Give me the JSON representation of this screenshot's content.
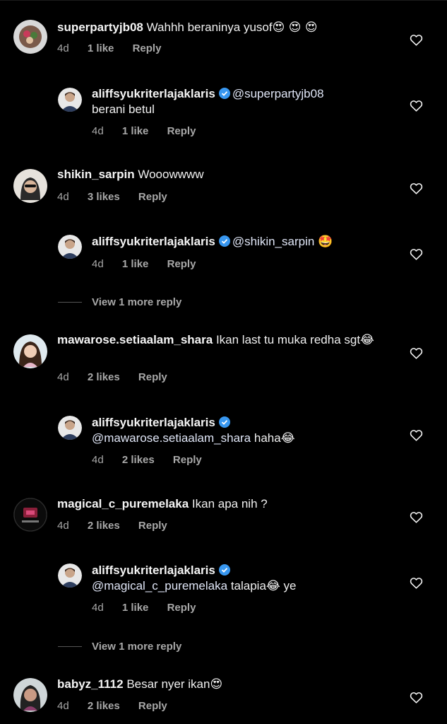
{
  "comments": [
    {
      "username": "superpartyjb08",
      "text": "Wahhh beraninya yusof",
      "emoji": "😍 😍 😍",
      "time": "4d",
      "likes": "1 like",
      "reply": "Reply"
    },
    {
      "username": "aliffsyukriterlajaklaris",
      "mention": "@superpartyjb08",
      "text": "berani betul",
      "time": "4d",
      "likes": "1 like",
      "reply": "Reply"
    },
    {
      "username": "shikin_sarpin",
      "text": "Wooowwww",
      "time": "4d",
      "likes": "3 likes",
      "reply": "Reply"
    },
    {
      "username": "aliffsyukriterlajaklaris",
      "mention": "@shikin_sarpin",
      "emoji": "🤩",
      "time": "4d",
      "likes": "1 like",
      "reply": "Reply"
    },
    {
      "view_more": "View 1 more reply"
    },
    {
      "username": "mawarose.setiaalam_shara",
      "text": "Ikan last tu muka redha sgt",
      "emoji": "😂",
      "time": "4d",
      "likes": "2 likes",
      "reply": "Reply"
    },
    {
      "username": "aliffsyukriterlajaklaris",
      "mention": "@mawarose.setiaalam_shara",
      "text": "haha",
      "emoji": "😂",
      "time": "4d",
      "likes": "2 likes",
      "reply": "Reply"
    },
    {
      "username": "magical_c_puremelaka",
      "text": "Ikan apa nih ?",
      "time": "4d",
      "likes": "2 likes",
      "reply": "Reply"
    },
    {
      "username": "aliffsyukriterlajaklaris",
      "mention": "@magical_c_puremelaka",
      "text": "talapia",
      "emoji": "😂",
      "text2": "ye",
      "time": "4d",
      "likes": "1 like",
      "reply": "Reply"
    },
    {
      "view_more": "View 1 more reply"
    },
    {
      "username": "babyz_1112",
      "text": "Besar nyer ikan",
      "emoji": "😍",
      "time": "4d",
      "likes": "2 likes",
      "reply": "Reply"
    }
  ],
  "colors": {
    "background": "#000000",
    "secondary_text": "#a8a8a8",
    "verified": "#3897f0"
  }
}
